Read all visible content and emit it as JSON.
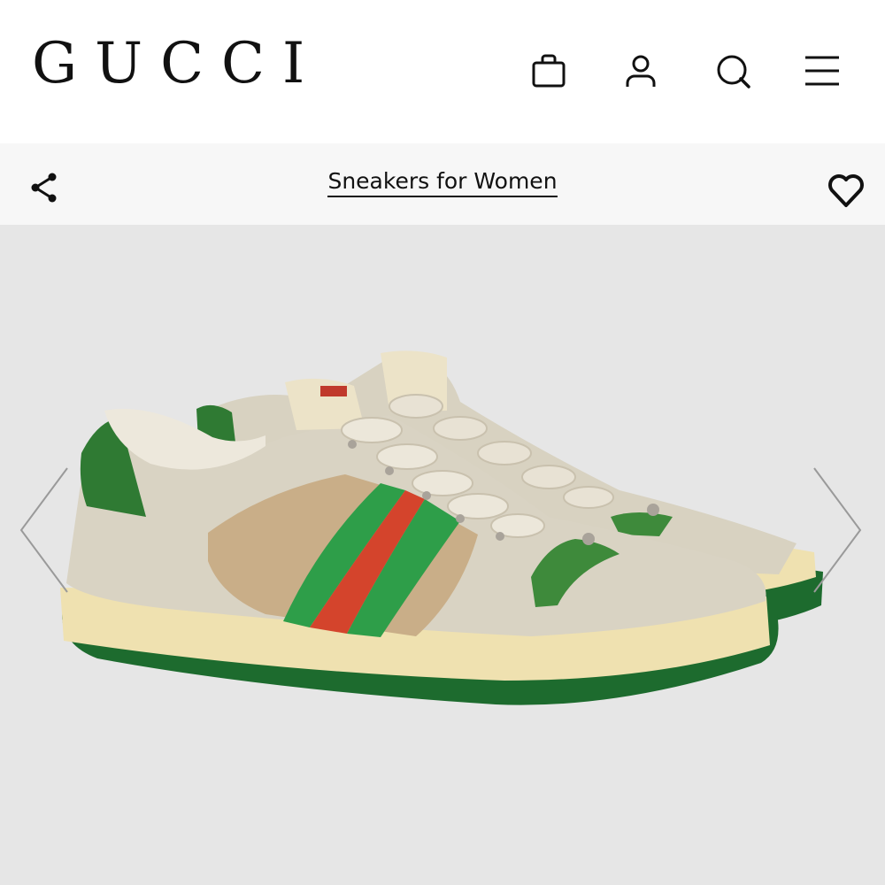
{
  "header": {
    "brand": "GUCCI",
    "icons": [
      "shopping-bag-icon",
      "account-icon",
      "search-icon",
      "menu-icon"
    ]
  },
  "subnav": {
    "category": "Sneakers for Women",
    "share_icon": "share-icon",
    "wishlist_icon": "heart-icon"
  },
  "gallery": {
    "prev_icon": "chevron-left-icon",
    "next_icon": "chevron-right-icon"
  },
  "colors": {
    "text": "#111111",
    "subnav_bg": "#f7f7f7",
    "gallery_bg": "#e6e6e6",
    "stripe_green": "#2e9e49",
    "stripe_red": "#d4442c",
    "sole_green": "#1d6b2e",
    "sole_cream": "#efe1b0"
  }
}
